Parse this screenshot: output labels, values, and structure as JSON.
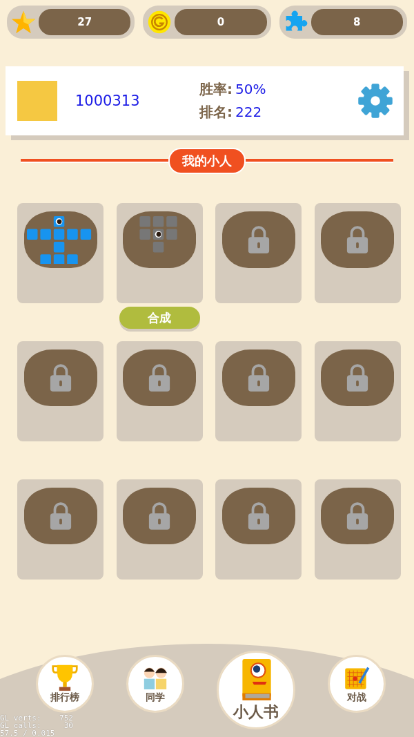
{
  "resources": [
    {
      "kind": "star",
      "value": "27"
    },
    {
      "kind": "coin",
      "value": "0"
    },
    {
      "kind": "puzzle",
      "value": "8"
    }
  ],
  "profile": {
    "player_id": "1000313",
    "win_rate_label": "胜率:",
    "win_rate": "50%",
    "rank_label": "排名:",
    "rank": "222"
  },
  "section_title": "我的小人",
  "slots": [
    {
      "kind": "cross-figure"
    },
    {
      "kind": "block-figure",
      "action": "合成"
    },
    {
      "kind": "locked"
    },
    {
      "kind": "locked"
    },
    {
      "kind": "locked"
    },
    {
      "kind": "locked"
    },
    {
      "kind": "locked"
    },
    {
      "kind": "locked"
    },
    {
      "kind": "locked"
    },
    {
      "kind": "locked"
    },
    {
      "kind": "locked"
    },
    {
      "kind": "locked"
    }
  ],
  "bottom_nav": [
    {
      "kind": "trophy",
      "label": "排行榜",
      "selected": false
    },
    {
      "kind": "classmates",
      "label": "同学",
      "selected": false
    },
    {
      "kind": "book",
      "label": "小人书",
      "selected": true
    },
    {
      "kind": "board",
      "label": "对战",
      "selected": false
    }
  ],
  "debug_overlay": [
    "GL verts:    752",
    "GL calls:     30",
    "57.5 / 0.015"
  ]
}
